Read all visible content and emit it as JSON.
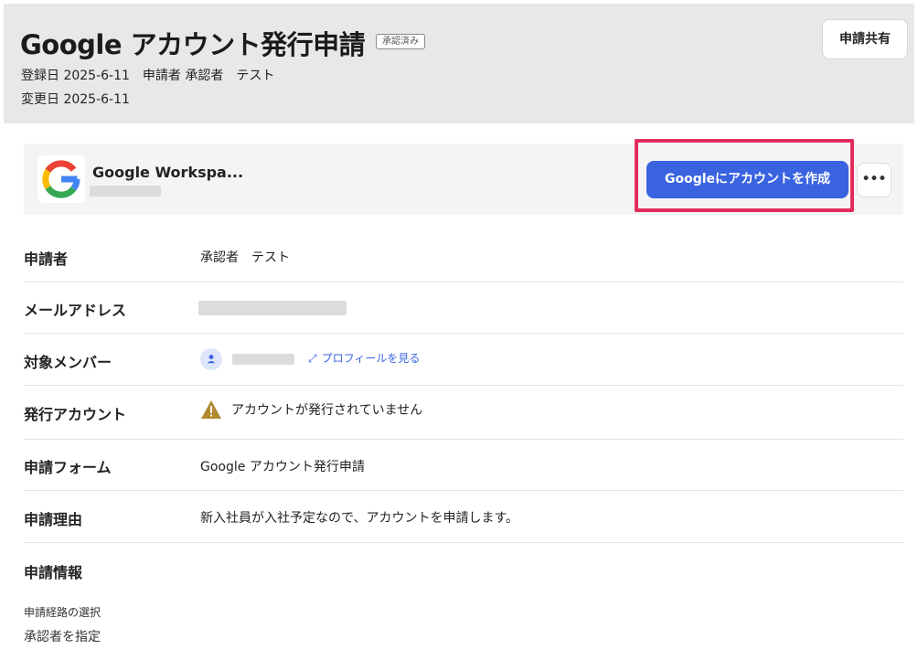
{
  "header": {
    "title": "Google アカウント発行申請",
    "status_badge": "承認済み",
    "registered": "登録日 2025-6-11",
    "applicant_meta": "申請者 承認者　テスト",
    "modified": "変更日 2025-6-11",
    "share_label": "申請共有"
  },
  "service_card": {
    "name": "Google Workspa...",
    "logo_icon": "google-g-icon",
    "create_button": "Googleにアカウントを作成",
    "more_icon": "more-horizontal-icon",
    "highlight_color": "#e32c5d",
    "button_color": "#3a63e0"
  },
  "details": {
    "applicant": {
      "label": "申請者",
      "value": "承認者　テスト"
    },
    "email": {
      "label": "メールアドレス"
    },
    "member": {
      "label": "対象メンバー",
      "profile_link": "プロフィールを見る",
      "avatar_icon": "user-icon",
      "link_icon": "expand-arrow-icon"
    },
    "account": {
      "label": "発行アカウント",
      "value": "アカウントが発行されていません",
      "warn_icon": "warning-triangle-icon"
    },
    "form": {
      "label": "申請フォーム",
      "value": "Google アカウント発行申請"
    },
    "reason": {
      "label": "申請理由",
      "value": "新入社員が入社予定なので、アカウントを申請します。"
    },
    "info": {
      "label": "申請情報",
      "route_label": "申請経路の選択",
      "route_value": "承認者を指定"
    }
  }
}
